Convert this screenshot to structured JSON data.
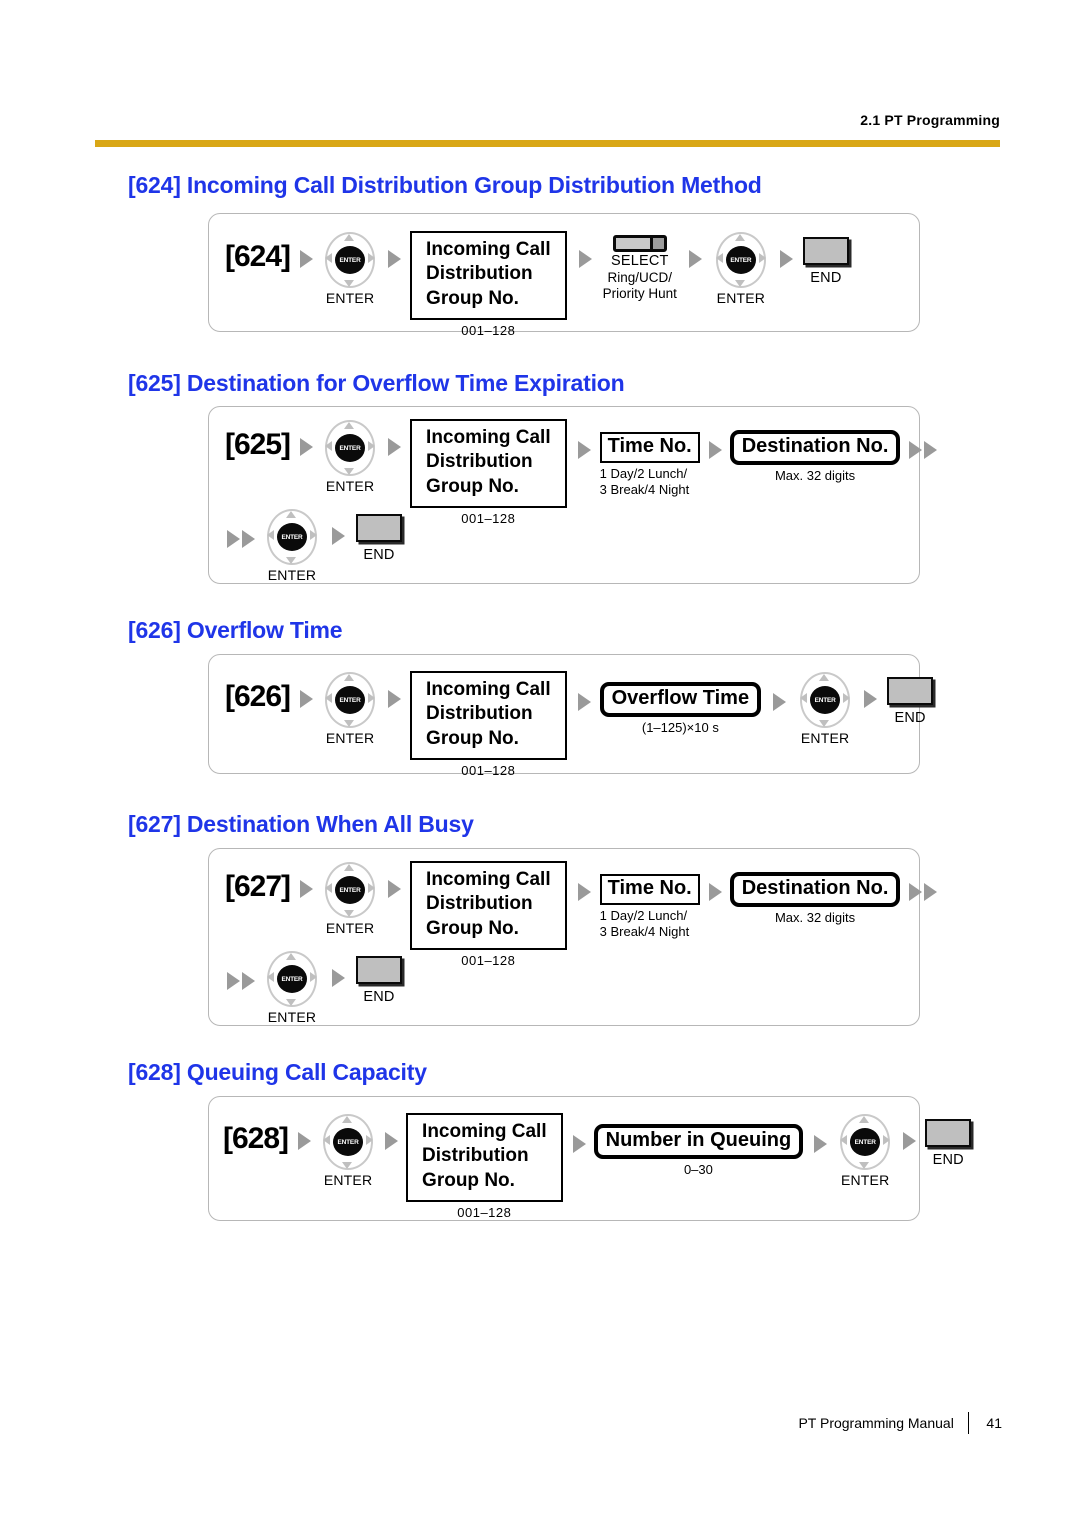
{
  "header": {
    "running_head": "2.1 PT Programming",
    "rule_color": "#D9A716"
  },
  "footer": {
    "manual_title": "PT Programming Manual",
    "page_number": "41"
  },
  "common": {
    "enter_caption": "ENTER",
    "enter_key_label": "ENTER",
    "end_caption": "END",
    "group_box": {
      "line1": "Incoming Call",
      "line2": "Distribution",
      "line3": "Group No.",
      "note": "001–128"
    },
    "time_no": {
      "label": "Time No.",
      "note_line1": "1 Day/2 Lunch/",
      "note_line2": "3 Break/4 Night"
    },
    "destination_no": {
      "label": "Destination No.",
      "note": "Max. 32 digits"
    },
    "heading_color": "#1F35E8"
  },
  "sections": [
    {
      "code": "624",
      "title": "[624] Incoming Call Distribution Group Distribution Method",
      "code_label": "[624]",
      "select": {
        "caption": "SELECT",
        "note_line1": "Ring/UCD/",
        "note_line2": "Priority Hunt"
      }
    },
    {
      "code": "625",
      "title": "[625] Destination for Overflow Time Expiration",
      "code_label": "[625]"
    },
    {
      "code": "626",
      "title": "[626] Overflow Time",
      "code_label": "[626]",
      "value_pill": {
        "label": "Overflow Time",
        "note": "(1–125)×10 s"
      }
    },
    {
      "code": "627",
      "title": "[627] Destination When All Busy",
      "code_label": "[627]"
    },
    {
      "code": "628",
      "title": "[628] Queuing Call Capacity",
      "code_label": "[628]",
      "value_pill": {
        "label": "Number in Queuing",
        "note": "0–30"
      }
    }
  ]
}
